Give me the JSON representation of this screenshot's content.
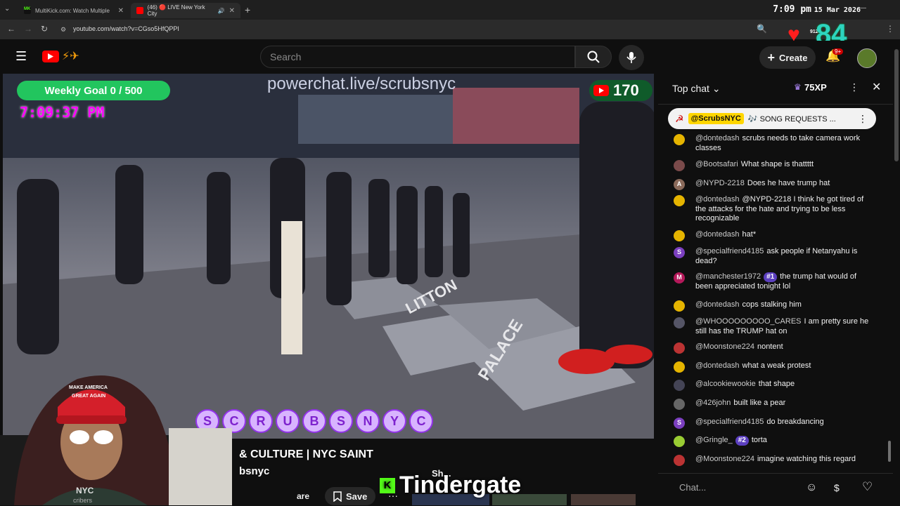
{
  "browser": {
    "tabs": [
      {
        "title": "MultiKick.com: Watch Multiple",
        "favicon": "MK"
      },
      {
        "title": "(46) 🔴 LIVE New York City",
        "favicon": "youtube"
      }
    ],
    "url": "youtube.com/watch?v=CGso5HfQPPI",
    "clock": "7:09 pm",
    "date": "15 Mar 2026",
    "badge_small": "912",
    "overlay_number": "84"
  },
  "header": {
    "search_placeholder": "Search",
    "create_label": "Create",
    "notif_count": "9+"
  },
  "video": {
    "weekly_goal": "Weekly Goal 0 / 500",
    "stream_time": "7:09:37 PM",
    "powerchat": "powerchat.live/scrubsnyc",
    "viewers": "170",
    "letters": [
      "S",
      "C",
      "R",
      "U",
      "B",
      "S",
      "N",
      "Y",
      "C"
    ],
    "street_text": [
      "LITTON",
      "PALACE",
      "LITTON"
    ]
  },
  "below": {
    "title_fragment": "& CULTURE | NYC SAINT",
    "channel_fragment": "bsnyc",
    "share_fragment": "are",
    "save_label": "Save",
    "shorts_fragment": "Sh...",
    "tindergate": "Tindergate",
    "webcam_hat_line1": "MAKE AMERICA",
    "webcam_hat_line2": "GREAT AGAIN",
    "webcam_channel": "NYC",
    "webcam_subs": "cribers"
  },
  "chat": {
    "title": "Top chat",
    "xp": "75XP",
    "pinned_author": "@ScrubsNYC",
    "pinned_text": "🎶 SONG REQUESTS ...",
    "input_placeholder": "Chat...",
    "messages": [
      {
        "author": "@dontedash",
        "text": "scrubs needs to take camera work classes",
        "avatar": "",
        "color": "#e5b400"
      },
      {
        "author": "@Bootsafari",
        "text": "What shape is thattttt",
        "avatar": "",
        "color": "#7a4a4a"
      },
      {
        "author": "@NYPD-2218",
        "text": "Does he have trump hat",
        "avatar": "A",
        "color": "#8a6a5a"
      },
      {
        "author": "@dontedash",
        "text": "@NYPD-2218 I think he got tired of the attacks for the hate and trying to be less recognizable",
        "avatar": "",
        "color": "#e5b400"
      },
      {
        "author": "@dontedash",
        "text": "hat*",
        "avatar": "",
        "color": "#e5b400"
      },
      {
        "author": "@specialfriend4185",
        "text": "ask people if Netanyahu is dead?",
        "avatar": "S",
        "color": "#7b3fbf"
      },
      {
        "author": "@manchester1972",
        "rank": "#1",
        "text": "the trump hat would of been appreciated tonight lol",
        "avatar": "M",
        "color": "#b5195a"
      },
      {
        "author": "@dontedash",
        "text": "cops stalking him",
        "avatar": "",
        "color": "#e5b400"
      },
      {
        "author": "@WHOOOOOOOOO_CARES",
        "text": "I am pretty sure he still has the TRUMP hat on",
        "avatar": "",
        "color": "#556"
      },
      {
        "author": "@Moonstone224",
        "text": "nontent",
        "avatar": "",
        "color": "#b33"
      },
      {
        "author": "@dontedash",
        "text": "what a weak protest",
        "avatar": "",
        "color": "#e5b400"
      },
      {
        "author": "@alcookiewookie",
        "text": "that shape",
        "avatar": "",
        "color": "#445"
      },
      {
        "author": "@426john",
        "text": "built like a pear",
        "avatar": "",
        "color": "#666"
      },
      {
        "author": "@specialfriend4185",
        "text": "do breakdancing",
        "avatar": "S",
        "color": "#7b3fbf"
      },
      {
        "author": "@Gringle_",
        "rank": "#2",
        "text": "torta",
        "avatar": "",
        "color": "#9c3"
      },
      {
        "author": "@Moonstone224",
        "text": "imagine watching this regard",
        "avatar": "",
        "color": "#b33"
      }
    ]
  }
}
